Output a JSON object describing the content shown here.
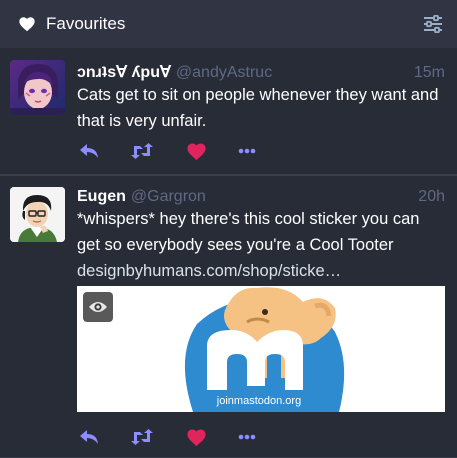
{
  "header": {
    "title": "Favourites",
    "title_icon": "heart-icon",
    "settings_icon": "sliders-icon"
  },
  "statuses": [
    {
      "display_name": "ɔnɹʇs∀ ʎpu∀",
      "acct": "@andyAstruc",
      "time": "15m",
      "content": "Cats get to sit on people whenever they want and that is very unfair.",
      "favourited": true
    },
    {
      "display_name": "Eugen",
      "acct": "@Gargron",
      "time": "20h",
      "content": "*whispers* hey there's this cool sticker you can get so everybody sees you're a Cool Tooter",
      "link": "designbyhumans.com/shop/sticke…",
      "media_caption": "joinmastodon.org",
      "favourited": true
    }
  ],
  "colors": {
    "background": "#282c37",
    "header": "#313543",
    "muted": "#606984",
    "favourite": "#e0245e",
    "action": "#8c8dff"
  }
}
